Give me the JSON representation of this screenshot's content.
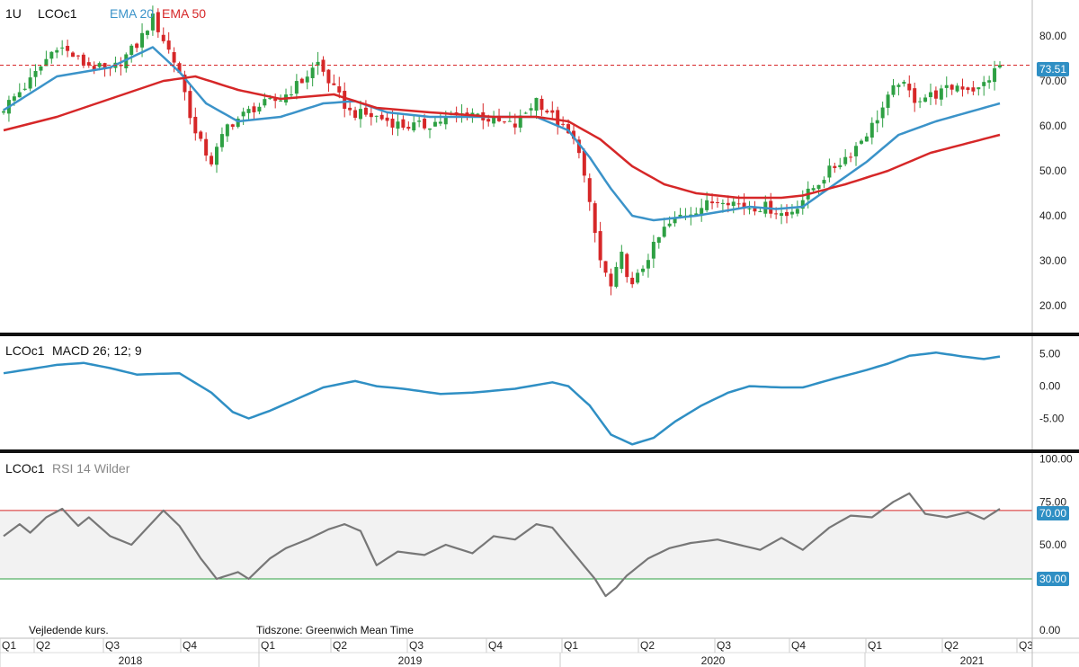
{
  "colors": {
    "up": "#2ea043",
    "down": "#d62728",
    "ema20": "#3b93c9",
    "ema50": "#d62728",
    "macd": "#2f8fc4",
    "rsi": "#777777",
    "rsi_hi": "#d62728",
    "rsi_lo": "#2ea043",
    "price_line": "#d62728",
    "tag_bg": "#2f8fc4"
  },
  "header": {
    "interval": "1U",
    "symbol": "LCOc1",
    "ema20_label": "EMA 20",
    "ema50_label": "EMA 50",
    "macd_label": "MACD 26; 12; 9",
    "rsi_label": "RSI 14 Wilder"
  },
  "footer": {
    "note": "Vejledende kurs.",
    "timezone": "Tidszone: Greenwich Mean Time"
  },
  "chart_data": [
    {
      "type": "candlestick",
      "name": "price",
      "last_price": "73.51",
      "ylim": [
        14,
        88
      ],
      "yticks": [
        "20.00",
        "30.00",
        "40.00",
        "50.00",
        "60.00",
        "70.00",
        "80.00"
      ],
      "x_quarters": [
        "Q1",
        "Q2",
        "Q3",
        "Q4",
        "Q1",
        "Q2",
        "Q3",
        "Q4",
        "Q1",
        "Q2",
        "Q3",
        "Q4",
        "Q1",
        "Q2",
        "Q3"
      ],
      "x_years": [
        "2018",
        "2019",
        "2020",
        "2021"
      ],
      "close_anchors": [
        [
          0,
          64
        ],
        [
          5,
          70
        ],
        [
          10,
          78
        ],
        [
          15,
          74
        ],
        [
          20,
          72
        ],
        [
          25,
          78
        ],
        [
          28,
          84
        ],
        [
          33,
          72
        ],
        [
          36,
          58
        ],
        [
          39,
          52
        ],
        [
          42,
          60
        ],
        [
          47,
          64
        ],
        [
          52,
          66
        ],
        [
          56,
          70
        ],
        [
          59,
          74
        ],
        [
          62,
          68
        ],
        [
          65,
          63
        ],
        [
          70,
          62
        ],
        [
          75,
          60
        ],
        [
          79,
          60
        ],
        [
          84,
          62
        ],
        [
          88,
          63
        ],
        [
          92,
          61
        ],
        [
          96,
          60
        ],
        [
          100,
          66
        ],
        [
          103,
          62
        ],
        [
          106,
          58
        ],
        [
          108,
          55
        ],
        [
          110,
          42
        ],
        [
          112,
          30
        ],
        [
          114,
          24
        ],
        [
          116,
          31
        ],
        [
          118,
          24
        ],
        [
          121,
          31
        ],
        [
          124,
          37
        ],
        [
          127,
          40
        ],
        [
          131,
          42
        ],
        [
          135,
          44
        ],
        [
          139,
          42
        ],
        [
          143,
          42
        ],
        [
          147,
          40
        ],
        [
          151,
          45
        ],
        [
          155,
          50
        ],
        [
          159,
          54
        ],
        [
          163,
          60
        ],
        [
          166,
          66
        ],
        [
          168,
          70
        ],
        [
          171,
          66
        ],
        [
          175,
          67
        ],
        [
          179,
          69
        ],
        [
          183,
          68
        ],
        [
          187,
          73.5
        ]
      ],
      "ema20_anchors": [
        [
          0,
          63.5
        ],
        [
          10,
          71
        ],
        [
          20,
          73
        ],
        [
          28,
          77.5
        ],
        [
          33,
          72
        ],
        [
          38,
          65
        ],
        [
          44,
          61
        ],
        [
          52,
          62
        ],
        [
          60,
          65
        ],
        [
          66,
          65.5
        ],
        [
          72,
          63
        ],
        [
          80,
          62
        ],
        [
          90,
          62
        ],
        [
          100,
          62
        ],
        [
          106,
          59
        ],
        [
          110,
          53
        ],
        [
          114,
          46
        ],
        [
          118,
          40
        ],
        [
          122,
          39
        ],
        [
          130,
          40
        ],
        [
          140,
          42
        ],
        [
          145,
          41.5
        ],
        [
          150,
          42
        ],
        [
          156,
          47
        ],
        [
          162,
          52
        ],
        [
          168,
          58
        ],
        [
          175,
          61
        ],
        [
          181,
          63
        ],
        [
          187,
          65
        ]
      ],
      "ema50_anchors": [
        [
          0,
          59
        ],
        [
          10,
          62
        ],
        [
          20,
          66
        ],
        [
          30,
          70
        ],
        [
          36,
          71
        ],
        [
          44,
          68
        ],
        [
          52,
          66
        ],
        [
          62,
          67
        ],
        [
          70,
          64
        ],
        [
          80,
          63
        ],
        [
          92,
          62
        ],
        [
          100,
          62
        ],
        [
          106,
          61
        ],
        [
          112,
          57
        ],
        [
          118,
          51
        ],
        [
          124,
          47
        ],
        [
          130,
          45
        ],
        [
          138,
          44
        ],
        [
          146,
          44
        ],
        [
          150,
          44.5
        ],
        [
          158,
          47
        ],
        [
          166,
          50
        ],
        [
          174,
          54
        ],
        [
          187,
          58
        ]
      ]
    },
    {
      "type": "line",
      "name": "MACD 26; 12; 9",
      "ylim": [
        -9.8,
        7.6
      ],
      "yticks": [
        "5.00",
        "0.00",
        "-5.00"
      ],
      "anchors": [
        [
          0,
          2.0
        ],
        [
          10,
          3.3
        ],
        [
          15,
          3.6
        ],
        [
          20,
          2.8
        ],
        [
          25,
          1.8
        ],
        [
          33,
          2.0
        ],
        [
          39,
          -1.0
        ],
        [
          43,
          -4.0
        ],
        [
          46,
          -5.0
        ],
        [
          50,
          -3.8
        ],
        [
          55,
          -2.0
        ],
        [
          60,
          -0.2
        ],
        [
          66,
          0.8
        ],
        [
          70,
          0.0
        ],
        [
          75,
          -0.4
        ],
        [
          82,
          -1.2
        ],
        [
          88,
          -1.0
        ],
        [
          96,
          -0.4
        ],
        [
          103,
          0.6
        ],
        [
          106,
          0.0
        ],
        [
          110,
          -3.0
        ],
        [
          114,
          -7.5
        ],
        [
          118,
          -9.0
        ],
        [
          122,
          -8.0
        ],
        [
          126,
          -5.5
        ],
        [
          131,
          -3.0
        ],
        [
          136,
          -1.0
        ],
        [
          140,
          0.0
        ],
        [
          146,
          -0.2
        ],
        [
          150,
          -0.2
        ],
        [
          156,
          1.2
        ],
        [
          162,
          2.5
        ],
        [
          166,
          3.5
        ],
        [
          170,
          4.7
        ],
        [
          175,
          5.2
        ],
        [
          180,
          4.6
        ],
        [
          184,
          4.2
        ],
        [
          187,
          4.6
        ]
      ]
    },
    {
      "type": "line",
      "name": "RSI 14 Wilder",
      "ylim": [
        -2,
        103
      ],
      "yticks": [
        "100.00",
        "75.00",
        "50.00",
        "0.00"
      ],
      "levels": {
        "upper": "70.00",
        "lower": "30.00"
      },
      "anchors": [
        [
          0,
          55
        ],
        [
          3,
          62
        ],
        [
          5,
          57
        ],
        [
          8,
          66
        ],
        [
          11,
          71
        ],
        [
          14,
          61
        ],
        [
          16,
          66
        ],
        [
          20,
          55
        ],
        [
          24,
          50
        ],
        [
          27,
          60
        ],
        [
          30,
          70
        ],
        [
          33,
          61
        ],
        [
          37,
          42
        ],
        [
          40,
          30
        ],
        [
          44,
          34
        ],
        [
          46,
          30
        ],
        [
          50,
          42
        ],
        [
          53,
          48
        ],
        [
          57,
          53
        ],
        [
          61,
          59
        ],
        [
          64,
          62
        ],
        [
          67,
          58
        ],
        [
          70,
          38
        ],
        [
          74,
          46
        ],
        [
          79,
          44
        ],
        [
          83,
          50
        ],
        [
          88,
          45
        ],
        [
          92,
          55
        ],
        [
          96,
          53
        ],
        [
          100,
          62
        ],
        [
          103,
          60
        ],
        [
          107,
          45
        ],
        [
          111,
          30
        ],
        [
          113,
          20
        ],
        [
          115,
          25
        ],
        [
          117,
          32
        ],
        [
          121,
          42
        ],
        [
          125,
          48
        ],
        [
          129,
          51
        ],
        [
          134,
          53
        ],
        [
          138,
          50
        ],
        [
          142,
          47
        ],
        [
          146,
          54
        ],
        [
          150,
          47
        ],
        [
          155,
          60
        ],
        [
          159,
          67
        ],
        [
          163,
          66
        ],
        [
          167,
          75
        ],
        [
          170,
          80
        ],
        [
          173,
          68
        ],
        [
          177,
          66
        ],
        [
          181,
          69
        ],
        [
          184,
          65
        ],
        [
          187,
          71
        ]
      ]
    }
  ]
}
